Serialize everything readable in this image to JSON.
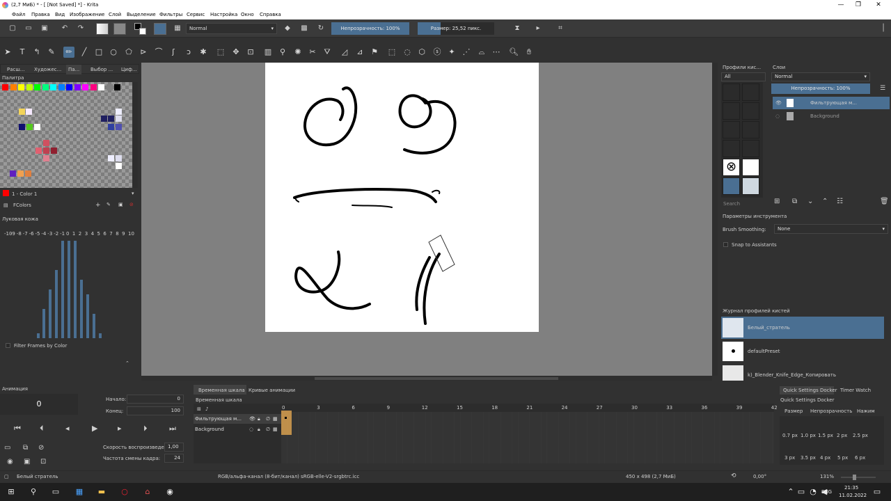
{
  "window": {
    "title": "(2,7 МиБ) * - [ [Not Saved] *] - Krita"
  },
  "menu": [
    "Файл",
    "Правка",
    "Вид",
    "Изображение",
    "Слой",
    "Выделение",
    "Фильтры",
    "Сервис",
    "Настройка",
    "Окно",
    "Справка"
  ],
  "toolbar": {
    "blend_mode": "Normal",
    "opacity_label": "Непрозрачность: 100%",
    "opacity_value": 1.0,
    "size_label": "Размер: 25,52 пикс.",
    "size_fraction": 0.3
  },
  "left_dock": {
    "tabs": [
      "Расш...",
      "Художес...",
      "Па...",
      "Выбор ...",
      "Циф..."
    ],
    "active_tab": 2,
    "palette_title": "Палитра",
    "palette_colors": [
      "#ff0000",
      "#ff8000",
      "#ffff00",
      "#c0ff00",
      "#00ff00",
      "#00ff80",
      "#00ffff",
      "#0080ff",
      "#0000ff",
      "#8000ff",
      "#ff00ff",
      "#ff0080",
      "#ffffff",
      "#808080",
      "#000000"
    ],
    "current_color_label": "1 - Color 1",
    "palette_name": "FColors",
    "onion_title": "Луковая кожа",
    "onion_numbers": [
      "-10",
      "-9",
      "-8",
      "-7",
      "-6",
      "-5",
      "-4",
      "-3",
      "-2",
      "-1",
      "0",
      "1",
      "2",
      "3",
      "4",
      "5",
      "6",
      "7",
      "8",
      "9",
      "10"
    ],
    "onion_levels": [
      0,
      0,
      0,
      0,
      0,
      0.05,
      0.3,
      0.5,
      0.7,
      1.0,
      1.0,
      1.0,
      0.6,
      0.45,
      0.25,
      0.05,
      0,
      0,
      0,
      0,
      0
    ],
    "filter_frames_label": "Filter Frames by Color"
  },
  "right_dock": {
    "brush_presets_title": "Профили кис...",
    "brush_filter": "All",
    "search_placeholder": "Search",
    "layers_title": "Слои",
    "layers_blend": "Normal",
    "layers_opacity_label": "Непрозрачность:  100%",
    "layers": [
      {
        "name": "Фильтрующая м...",
        "selected": true
      },
      {
        "name": "Background",
        "selected": false
      }
    ],
    "tool_options_title": "Параметры инструмента",
    "brush_smoothing_label": "Brush Smoothing:",
    "brush_smoothing_value": "None",
    "snap_label": "Snap to Assistants",
    "history_title": "Журнал профилей кистей",
    "history": [
      {
        "name": "Белый_стратель",
        "selected": true
      },
      {
        "name": "defaultPreset",
        "selected": false
      },
      {
        "name": "k)_Blender_Knife_Edge_Копировать",
        "selected": false
      }
    ]
  },
  "animation": {
    "title": "Анимация",
    "current_frame": "0",
    "start_label": "Начало:",
    "start_value": "0",
    "end_label": "Конец:",
    "end_value": "100",
    "speed_label": "Скорость воспроизведения:",
    "speed_value": "1,00",
    "fps_label": "Частота смены кадра:",
    "fps_value": "24"
  },
  "timeline": {
    "tabs": [
      "Временная шкала",
      "Кривые анимации"
    ],
    "title": "Временная шкала",
    "frames": [
      "0",
      "3",
      "6",
      "9",
      "12",
      "15",
      "18",
      "21",
      "24",
      "27",
      "30",
      "33",
      "36",
      "39",
      "42"
    ],
    "layers": [
      "Фильтрующая м...",
      "Background"
    ]
  },
  "quick_settings": {
    "tabs": [
      "Quick Settings Docker",
      "Timer Watch"
    ],
    "title": "Quick Settings Docker",
    "subtabs": [
      "Размер",
      "Непрозрачность",
      "Нажим"
    ],
    "sizes_row1": [
      "0.7 px",
      "1.0 px",
      "1.5 px",
      "2 px",
      "2.5 px"
    ],
    "sizes_row2": [
      "3 px",
      "3.5 px",
      "4 px",
      "5 px",
      "6 px"
    ]
  },
  "statusbar": {
    "brush": "Белый стратель",
    "colorspace": "RGB/альфа-канал (8-бит/канал)  sRGB-elle-V2-srgbtrc.icc",
    "dimensions": "450 x 498 (2,7 МиБ)",
    "rotation": "0,00°",
    "zoom": "131%"
  },
  "taskbar": {
    "lang": "ENG",
    "time": "21:35",
    "date": "11.02.2022"
  }
}
